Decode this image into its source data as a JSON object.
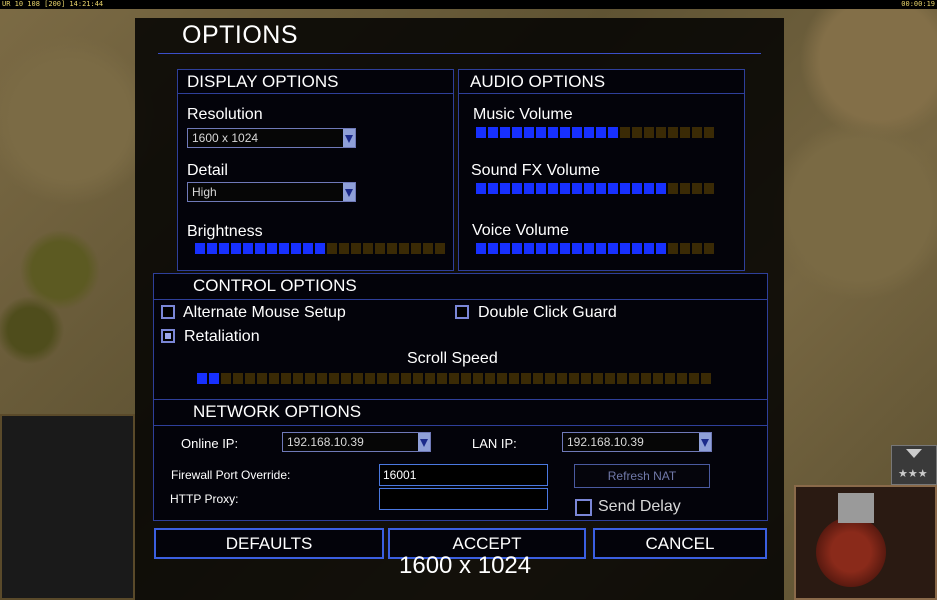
{
  "hud": {
    "left": "UR 10 108 [200] 14:21:44",
    "right": "00:00:19"
  },
  "title": "OPTIONS",
  "display": {
    "header": "DISPLAY OPTIONS",
    "resolution_label": "Resolution",
    "resolution_value": "1600 x 1024",
    "detail_label": "Detail",
    "detail_value": "High",
    "brightness_label": "Brightness",
    "brightness_level": 0.52
  },
  "audio": {
    "header": "AUDIO OPTIONS",
    "music_label": "Music Volume",
    "music_level": 0.6,
    "sfx_label": "Sound FX Volume",
    "sfx_level": 0.8,
    "voice_label": "Voice Volume",
    "voice_level": 0.8
  },
  "control": {
    "header": "CONTROL OPTIONS",
    "alt_mouse_label": "Alternate Mouse Setup",
    "alt_mouse_checked": false,
    "double_click_label": "Double Click Guard",
    "double_click_checked": false,
    "retaliation_label": "Retaliation",
    "retaliation_checked": true,
    "scroll_label": "Scroll Speed",
    "scroll_level": 0.04
  },
  "network": {
    "header": "NETWORK OPTIONS",
    "online_ip_label": "Online IP:",
    "online_ip_value": "192.168.10.39",
    "lan_ip_label": "LAN IP:",
    "lan_ip_value": "192.168.10.39",
    "firewall_label": "Firewall Port Override:",
    "firewall_value": "16001",
    "proxy_label": "HTTP Proxy:",
    "proxy_value": "",
    "refresh_label": "Refresh NAT",
    "send_delay_label": "Send Delay",
    "send_delay_checked": false
  },
  "buttons": {
    "defaults": "DEFAULTS",
    "accept": "ACCEPT",
    "cancel": "CANCEL"
  },
  "resolution_overlay": "1600 x 1024",
  "colors": {
    "accent": "#1730ff",
    "panel_border": "#2e3f9a",
    "slider_off": "#3a2a05"
  }
}
